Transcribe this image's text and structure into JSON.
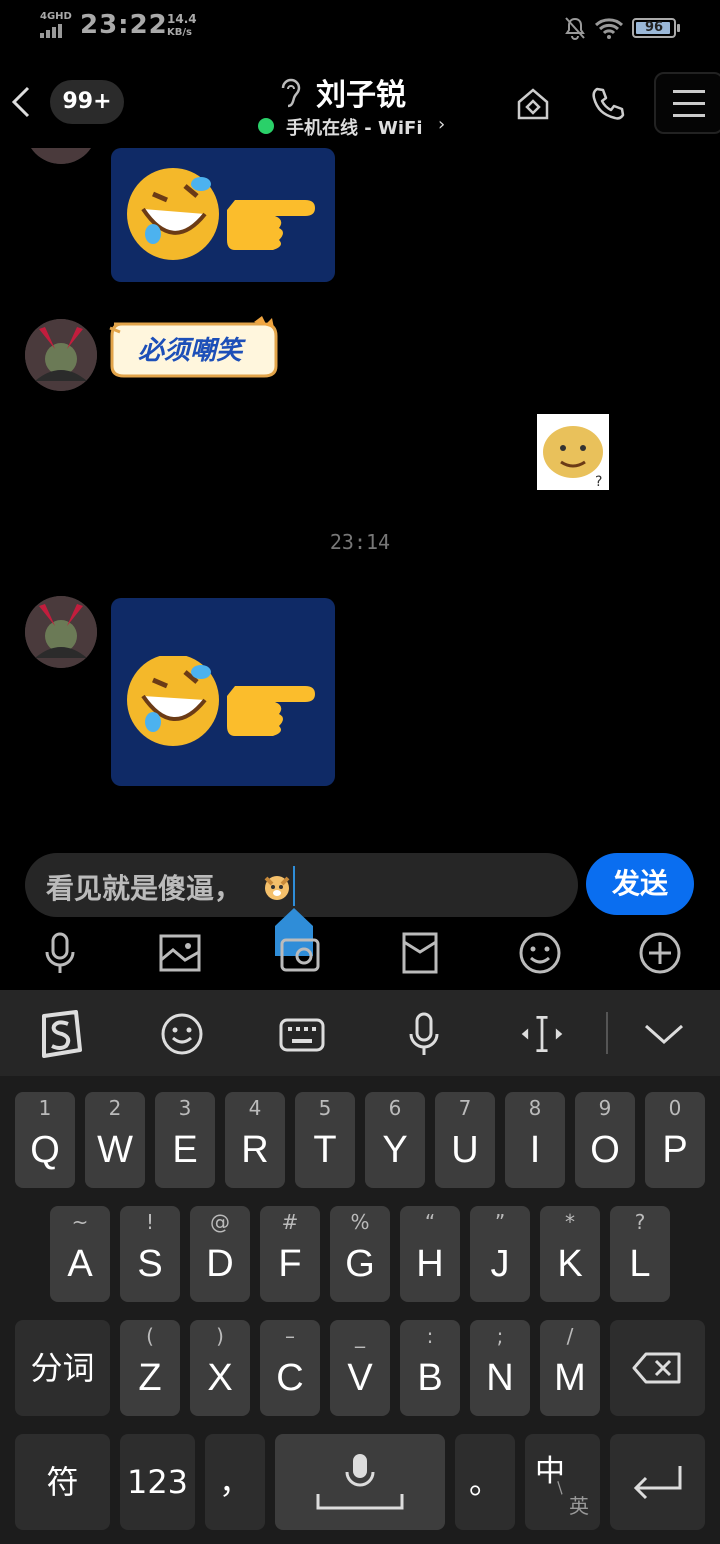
{
  "status": {
    "network": "4GHD",
    "time": "23:22",
    "speed_value": "14.4",
    "speed_unit": "KB/s",
    "battery": "96"
  },
  "header": {
    "unread_badge": "99+",
    "contact_name": "刘子锐",
    "online_status": "手机在线 - WiFi",
    "chevron": "›"
  },
  "chat": {
    "sticker_text": "必须嘲笑",
    "timestamp": "23:14"
  },
  "composer": {
    "text": "看见就是傻逼，",
    "send_label": "发送"
  },
  "keyboard": {
    "row1": [
      {
        "sub": "1",
        "key": "Q"
      },
      {
        "sub": "2",
        "key": "W"
      },
      {
        "sub": "3",
        "key": "E"
      },
      {
        "sub": "4",
        "key": "R"
      },
      {
        "sub": "5",
        "key": "T"
      },
      {
        "sub": "6",
        "key": "Y"
      },
      {
        "sub": "7",
        "key": "U"
      },
      {
        "sub": "8",
        "key": "I"
      },
      {
        "sub": "9",
        "key": "O"
      },
      {
        "sub": "0",
        "key": "P"
      }
    ],
    "row2": [
      {
        "sub": "~",
        "key": "A"
      },
      {
        "sub": "!",
        "key": "S"
      },
      {
        "sub": "@",
        "key": "D"
      },
      {
        "sub": "#",
        "key": "F"
      },
      {
        "sub": "%",
        "key": "G"
      },
      {
        "sub": "“",
        "key": "H"
      },
      {
        "sub": "”",
        "key": "J"
      },
      {
        "sub": "*",
        "key": "K"
      },
      {
        "sub": "?",
        "key": "L"
      }
    ],
    "row3": [
      {
        "sub": "(",
        "key": "Z"
      },
      {
        "sub": ")",
        "key": "X"
      },
      {
        "sub": "–",
        "key": "C"
      },
      {
        "sub": "_",
        "key": "V"
      },
      {
        "sub": ":",
        "key": "B"
      },
      {
        "sub": ";",
        "key": "N"
      },
      {
        "sub": "/",
        "key": "M"
      }
    ],
    "segment_label": "分词",
    "symbol_label": "符",
    "numbers_label": "123",
    "comma_label": "，",
    "period_label": "。",
    "lang_primary": "中",
    "lang_secondary": "英"
  }
}
